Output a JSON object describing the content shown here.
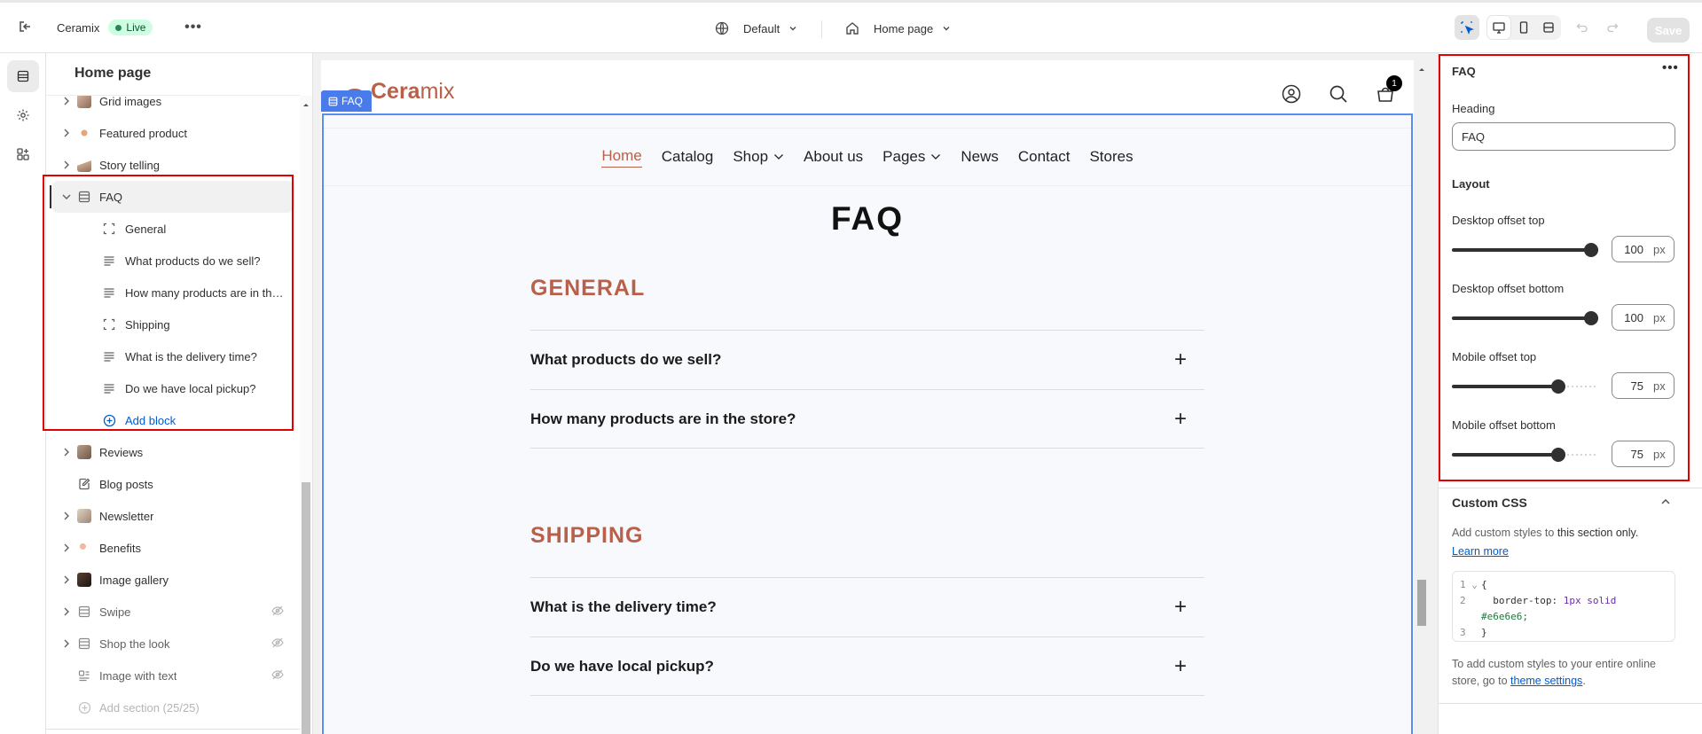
{
  "topbar": {
    "store_name": "Ceramix",
    "live_label": "Live",
    "theme_selector": "Default",
    "page_selector": "Home page",
    "save_label": "Save"
  },
  "sidebar": {
    "title": "Home page",
    "sections": [
      {
        "label": "Grid images"
      },
      {
        "label": "Featured product"
      },
      {
        "label": "Story telling"
      },
      {
        "label": "FAQ"
      }
    ],
    "faq_blocks": [
      {
        "label": "General",
        "icon": "group-icon"
      },
      {
        "label": "What products do we sell?",
        "icon": "text-icon"
      },
      {
        "label": "How many products are in the store?",
        "icon": "text-icon"
      },
      {
        "label": "Shipping",
        "icon": "group-icon"
      },
      {
        "label": "What is the delivery time?",
        "icon": "text-icon"
      },
      {
        "label": "Do we have local pickup?",
        "icon": "text-icon"
      }
    ],
    "add_block_label": "Add block",
    "more_sections": [
      {
        "label": "Reviews"
      },
      {
        "label": "Blog posts"
      },
      {
        "label": "Newsletter"
      },
      {
        "label": "Benefits"
      },
      {
        "label": "Image gallery"
      },
      {
        "label": "Swipe"
      },
      {
        "label": "Shop the look"
      },
      {
        "label": "Image with text"
      }
    ],
    "add_section_label": "Add section (25/25)"
  },
  "preview": {
    "section_tag": "FAQ",
    "logo_text_bold": "Cera",
    "logo_text_light": "mix",
    "cart_count": "1",
    "nav": [
      "Home",
      "Catalog",
      "Shop",
      "About us",
      "Pages",
      "News",
      "Contact",
      "Stores"
    ],
    "faq_title": "FAQ",
    "groups": [
      {
        "title": "GENERAL",
        "questions": [
          "What products do we sell?",
          "How many products are in the store?"
        ]
      },
      {
        "title": "SHIPPING",
        "questions": [
          "What is the delivery time?",
          "Do we have local pickup?"
        ]
      }
    ]
  },
  "settings": {
    "panel_title": "FAQ",
    "heading_label": "Heading",
    "heading_value": "FAQ",
    "layout_label": "Layout",
    "desktop_top_label": "Desktop offset top",
    "desktop_top_value": "100",
    "desktop_bottom_label": "Desktop offset bottom",
    "desktop_bottom_value": "100",
    "mobile_top_label": "Mobile offset top",
    "mobile_top_value": "75",
    "mobile_bottom_label": "Mobile offset bottom",
    "mobile_bottom_value": "75",
    "unit": "px",
    "custom_css_title": "Custom CSS",
    "custom_css_desc_1": "Add custom styles to ",
    "custom_css_desc_bold": "this section only.",
    "learn_more": "Learn more",
    "code_line1": "{",
    "code_line2a": "border-top: ",
    "code_line2b": "1px solid",
    "code_line2c": "#e6e6e6;",
    "code_line3": "}",
    "footer_text": "To add custom styles to your entire online store, go to ",
    "footer_link": "theme settings",
    "footer_end": "."
  },
  "colors": {
    "accent": "#b86049",
    "selection": "#5b8def",
    "highlight_box": "#e30000"
  }
}
